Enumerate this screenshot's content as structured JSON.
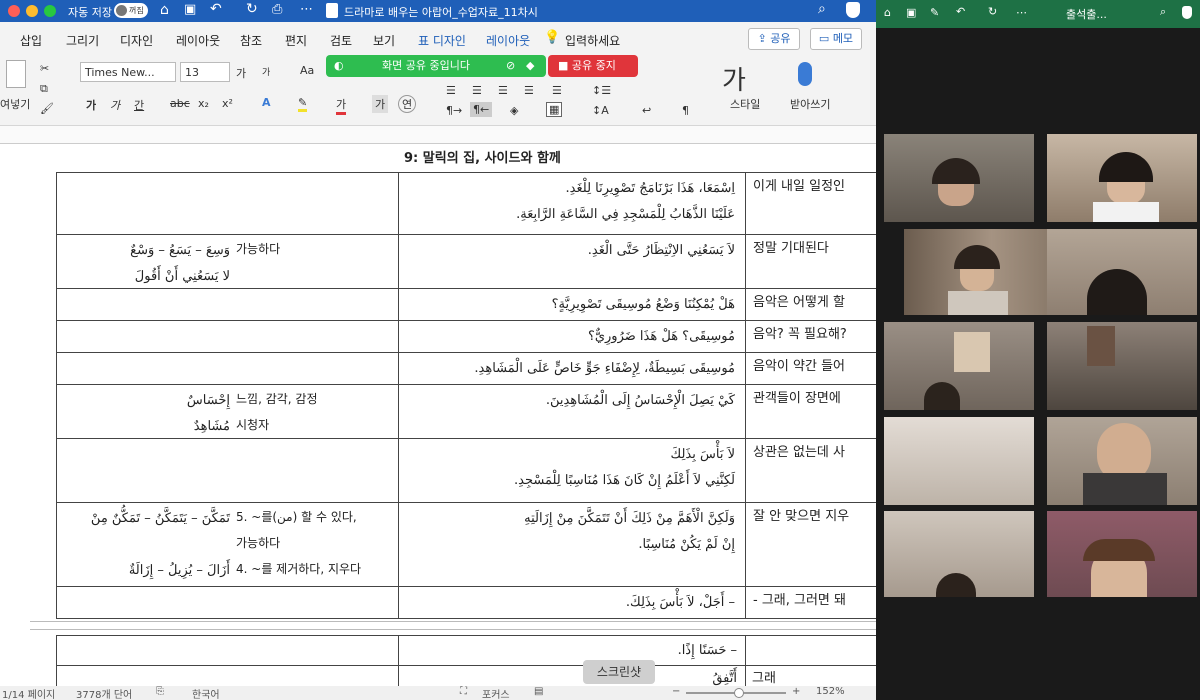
{
  "titlebar": {
    "autosave": "자동 저장",
    "autosave_state": "꺼짐",
    "doc_title": "드라마로 배우는 아랍어_수업자료_11차시"
  },
  "menu": [
    "삽입",
    "그리기",
    "디자인",
    "레이아웃",
    "참조",
    "편지",
    "검토",
    "보기",
    "표 디자인",
    "레이아웃"
  ],
  "menu_search": "입력하세요",
  "share_btn": "공유",
  "memo_btn": "메모",
  "font": {
    "name": "Times New...",
    "size": "13"
  },
  "ribbon": {
    "paste": "여넣기",
    "style": "스타일",
    "dictate": "받아쓰기",
    "aa": "Aa",
    "ga1": "가",
    "ga2": "가",
    "bold": "가",
    "italic": "가",
    "underline": "간",
    "sub": "x₂",
    "sup": "x²"
  },
  "sharebar": {
    "sharing": "화면 공유 중입니다",
    "stop": "공유 중지"
  },
  "heading": "9: 말릭의 집, 사이드와 함께",
  "rows": [
    {
      "vocab_ar": [],
      "vocab_ko": [],
      "text_ar": [
        "اِسْمَعَا، هَذَا بَرْنَامَجُ تَصْوِيرِنَا لِلْغَدِ.",
        "عَلَيْنَا الذَّهَابُ لِلْمَسْجِدِ فِي السَّاعَةِ الرَّابِعَةِ."
      ],
      "ko": "이게 내일 일정인"
    },
    {
      "vocab_ar": [
        "وَسِعَ – يَسَعُ – وَسْعٌ",
        "لا يَسَعُنِي أَنْ أَقُولَ"
      ],
      "vocab_ko": [
        "가능하다",
        ""
      ],
      "text_ar": [
        "لاَ يَسَعُنِي الاِنْتِظَارُ حَتَّى الْغَدِ."
      ],
      "ko": "정말 기대된다"
    },
    {
      "vocab_ar": [],
      "vocab_ko": [],
      "text_ar": [
        "هَلْ يُمْكِنُنَا وَضْعُ مُوسِيقَى تَصْوِيرِيَّةٍ؟"
      ],
      "ko": "음악은 어떻게 할"
    },
    {
      "vocab_ar": [],
      "vocab_ko": [],
      "text_ar": [
        "مُوسِيقَى؟ هَلْ هَذَا ضَرُورِيٌّ؟"
      ],
      "ko": "음악? 꼭 필요해?"
    },
    {
      "vocab_ar": [],
      "vocab_ko": [],
      "text_ar": [
        "مُوسِيقَى بَسِيطَةٌ، لِإِضْفَاءِ جَوٍّ خَاصٍّ عَلَى الْمَشَاهِدِ."
      ],
      "ko": "음악이 약간 들어"
    },
    {
      "vocab_ar": [
        "إِحْسَاسٌ",
        "مُشَاهِدٌ"
      ],
      "vocab_ko": [
        "느낌, 감각, 감정",
        "시청자"
      ],
      "text_ar": [
        "كَيْ يَصِلَ الْإِحْسَاسُ إِلَى الْمُشَاهِدِينَ."
      ],
      "ko": "관객들이 장면에"
    },
    {
      "vocab_ar": [],
      "vocab_ko": [],
      "text_ar": [
        "لاَ بَأْسَ بِذَلِكَ",
        "لَكِنَّنِي لاَ أَعْلَمُ إِنْ كَانَ هَذَا مُنَاسِبًا لِلْمَسْجِدِ."
      ],
      "ko": "상관은 없는데 사"
    },
    {
      "vocab_ar": [
        "تَمَكَّنَ – يَتَمَكَّنُ – تَمَكُّنٌ مِنْ",
        "أَزَالَ – يُزِيلُ – إِزَالَةٌ"
      ],
      "vocab_ko": [
        "5. ~를(من) 할 수 있다,",
        "가능하다",
        "4. ~를 제거하다, 지우다"
      ],
      "text_ar": [
        "وَلَكِنَّ الْأَهَمَّ مِنْ ذَلِكَ أَنْ تَتَمَكَّنَ مِنْ إِزَالَتِهِ",
        "إِنْ لَمْ يَكُنْ مُنَاسِبًا."
      ],
      "ko": "잘 안 맞으면 지우"
    },
    {
      "vocab_ar": [],
      "vocab_ko": [],
      "text_ar": [
        "– أَجَلْ، لاَ بَأْسَ بِذَلِكَ."
      ],
      "ko": "- 그래, 그러면 돼"
    }
  ],
  "page2": {
    "text1": "– حَسَنًا إِذًا.",
    "text2": "أَتَّفِقُ",
    "ko": "그래"
  },
  "status": {
    "page": "1/14 페이지",
    "words": "3778개 단어",
    "lang": "한국어",
    "focus": "포커스",
    "zoom": "152%"
  },
  "screenshot_tooltip": "스크린샷",
  "excel": {
    "title": "출석출..."
  },
  "colors": {
    "word_blue": "#1f5fb8",
    "share_green": "#2ebd50",
    "share_red": "#e0353b",
    "highlight_green": "#d8efcf",
    "highlight_yellow": "#fbe99c"
  }
}
